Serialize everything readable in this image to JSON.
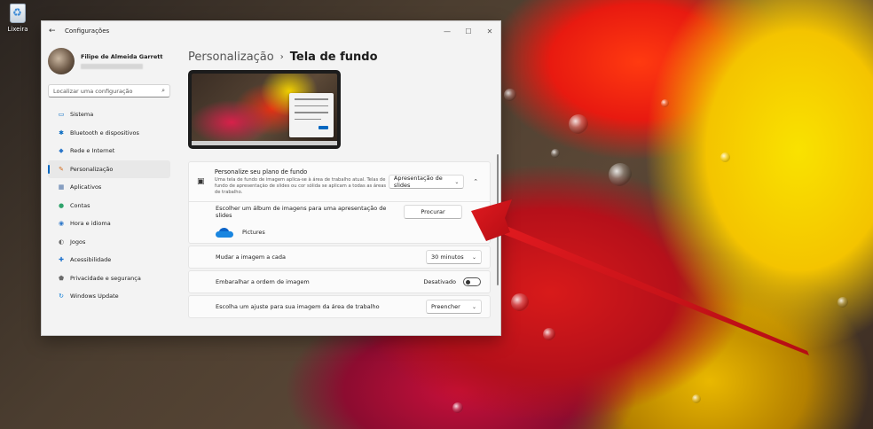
{
  "desktop": {
    "recycle_bin_label": "Lixeira"
  },
  "window": {
    "title": "Configurações",
    "controls": {
      "minimize": "—",
      "maximize": "☐",
      "close": "✕"
    },
    "back_icon": "←"
  },
  "profile": {
    "name": "Filipe de Almeida Garrett"
  },
  "search": {
    "placeholder": "Localizar uma configuração",
    "icon": "⌕"
  },
  "sidebar": {
    "items": [
      {
        "label": "Sistema",
        "icon": "▭",
        "color": "#0067c0"
      },
      {
        "label": "Bluetooth e dispositivos",
        "icon": "✱",
        "color": "#0067c0"
      },
      {
        "label": "Rede e Internet",
        "icon": "◆",
        "color": "#2b76c9"
      },
      {
        "label": "Personalização",
        "icon": "✎",
        "color": "#d36a1a"
      },
      {
        "label": "Aplicativos",
        "icon": "▦",
        "color": "#4a6fa5"
      },
      {
        "label": "Contas",
        "icon": "●",
        "color": "#2fa36b"
      },
      {
        "label": "Hora e idioma",
        "icon": "◉",
        "color": "#2b76c9"
      },
      {
        "label": "Jogos",
        "icon": "◐",
        "color": "#6b6b6b"
      },
      {
        "label": "Acessibilidade",
        "icon": "✚",
        "color": "#1a6fcc"
      },
      {
        "label": "Privacidade e segurança",
        "icon": "⬟",
        "color": "#6b6b6b"
      },
      {
        "label": "Windows Update",
        "icon": "↻",
        "color": "#0c7bd6"
      }
    ],
    "active_index": 3
  },
  "breadcrumb": {
    "parent": "Personalização",
    "separator": "›",
    "current": "Tela de fundo"
  },
  "background_setting": {
    "title": "Personalize seu plano de fundo",
    "description": "Uma tela de fundo de imagem aplica-se à área de trabalho atual. Telas de fundo de apresentação de slides ou cor sólida se aplicam a todas as áreas de trabalho.",
    "selected": "Apresentação de slides",
    "icon": "picture-icon",
    "album_label": "Escolher um álbum de imagens para uma apresentação de slides",
    "browse_button": "Procurar",
    "album_name": "Pictures"
  },
  "settings": [
    {
      "label": "Mudar a imagem a cada",
      "type": "dropdown",
      "value": "30 minutos"
    },
    {
      "label": "Embaralhar a ordem de imagem",
      "type": "toggle",
      "value": "Desativado",
      "on": false
    },
    {
      "label": "Escolha um ajuste para sua imagem da área de trabalho",
      "type": "dropdown",
      "value": "Preencher"
    }
  ],
  "accent_color": "#0067c0",
  "annotation_arrow_color": "#d4111b"
}
